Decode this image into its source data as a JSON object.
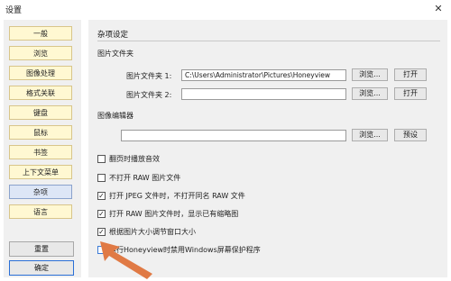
{
  "window": {
    "title": "设置",
    "close_glyph": "✕"
  },
  "sidebar": {
    "items": [
      {
        "label": "一般",
        "active": false
      },
      {
        "label": "浏览",
        "active": false
      },
      {
        "label": "图像处理",
        "active": false
      },
      {
        "label": "格式关联",
        "active": false
      },
      {
        "label": "键盘",
        "active": false
      },
      {
        "label": "鼠标",
        "active": false
      },
      {
        "label": "书签",
        "active": false
      },
      {
        "label": "上下文菜单",
        "active": false
      },
      {
        "label": "杂项",
        "active": true
      },
      {
        "label": "语言",
        "active": false
      }
    ],
    "reset_label": "重置",
    "ok_label": "确定"
  },
  "main": {
    "section_title": "杂项设定",
    "picture_folder": {
      "group_label": "图片文件夹",
      "folder1_label": "图片文件夹 1:",
      "folder1_value": "C:\\Users\\Administrator\\Pictures\\Honeyview",
      "folder2_label": "图片文件夹 2:",
      "folder2_value": "",
      "browse_label": "浏览...",
      "open_label": "打开"
    },
    "image_editor": {
      "group_label": "图像编辑器",
      "value": "",
      "browse_label": "浏览...",
      "preset_label": "预设"
    },
    "options": [
      {
        "label": "翻页时播放音效",
        "checked": false
      },
      {
        "label": "不打开 RAW 图片文件",
        "checked": false
      },
      {
        "label": "打开 JPEG 文件时，不打开同名 RAW 文件",
        "checked": true
      },
      {
        "label": "打开 RAW 图片文件时，显示已有缩略图",
        "checked": true
      },
      {
        "label": "根据图片大小调节窗口大小",
        "checked": true
      },
      {
        "label": "运行Honeyview时禁用Windows屏幕保护程序",
        "checked": false
      }
    ]
  },
  "colors": {
    "accent": "#2a6fd6",
    "nav_bg": "#fff8d2",
    "nav_active_bg": "#dde6f6",
    "arrow": "#e07a45"
  },
  "icons": {
    "close": "close-icon",
    "check": "check-icon",
    "arrow": "arrow-pointer-icon"
  }
}
